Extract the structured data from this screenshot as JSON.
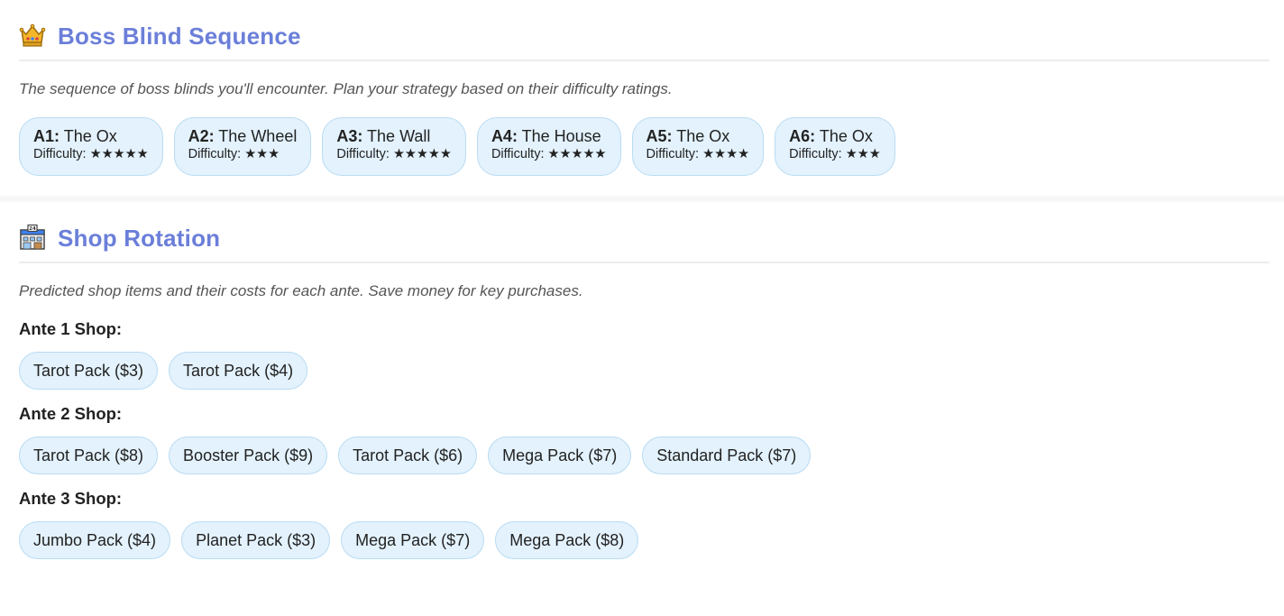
{
  "boss_section": {
    "icon": "crown-icon",
    "title": "Boss Blind Sequence",
    "description": "The sequence of boss blinds you'll encounter. Plan your strategy based on their difficulty ratings.",
    "difficulty_label": "Difficulty:",
    "bosses": [
      {
        "ante": "A1:",
        "name": "The Ox",
        "stars": "★★★★★"
      },
      {
        "ante": "A2:",
        "name": "The Wheel",
        "stars": "★★★"
      },
      {
        "ante": "A3:",
        "name": "The Wall",
        "stars": "★★★★★"
      },
      {
        "ante": "A4:",
        "name": "The House",
        "stars": "★★★★★"
      },
      {
        "ante": "A5:",
        "name": "The Ox",
        "stars": "★★★★"
      },
      {
        "ante": "A6:",
        "name": "The Ox",
        "stars": "★★★"
      }
    ]
  },
  "shop_section": {
    "icon": "convenience-store-icon",
    "title": "Shop Rotation",
    "description": "Predicted shop items and their costs for each ante. Save money for key purchases.",
    "antes": [
      {
        "label": "Ante 1 Shop:",
        "items": [
          "Tarot Pack ($3)",
          "Tarot Pack ($4)"
        ]
      },
      {
        "label": "Ante 2 Shop:",
        "items": [
          "Tarot Pack ($8)",
          "Booster Pack ($9)",
          "Tarot Pack ($6)",
          "Mega Pack ($7)",
          "Standard Pack ($7)"
        ]
      },
      {
        "label": "Ante 3 Shop:",
        "items": [
          "Jumbo Pack ($4)",
          "Planet Pack ($3)",
          "Mega Pack ($7)",
          "Mega Pack ($8)"
        ]
      }
    ]
  },
  "colors": {
    "title": "#6b7fd9",
    "pill_bg": "#e3f2fd",
    "pill_border": "#b9dcf3"
  }
}
